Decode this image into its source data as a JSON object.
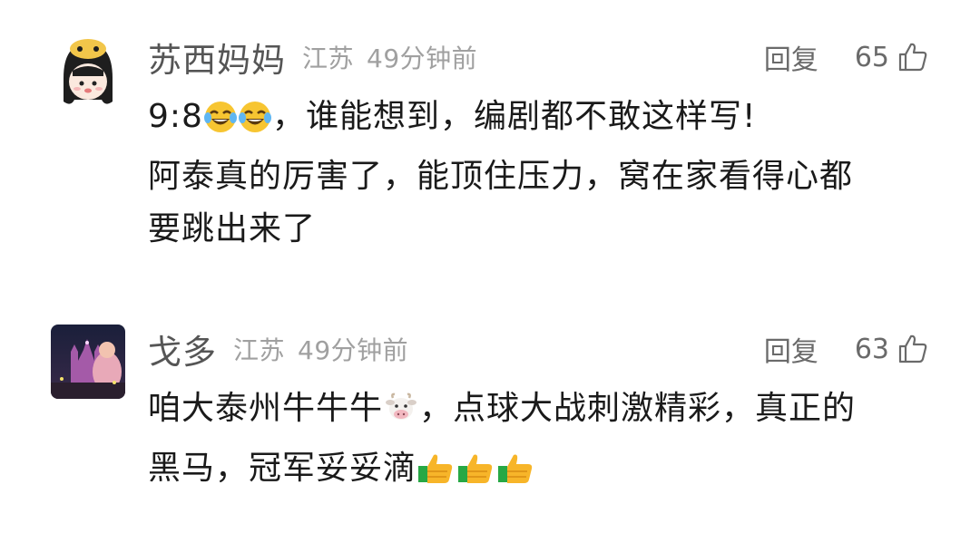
{
  "comments": [
    {
      "username": "苏西妈妈",
      "location": "江苏",
      "time": "49分钟前",
      "reply_label": "回复",
      "likes": "65",
      "avatar": "cartoon-girl-avatar",
      "lines": [
        [
          "9:8",
          "",
          "",
          "，谁能想到，编剧都不敢这样写!"
        ],
        [
          "阿泰真的厉害了，能顶住压力，窝在家看得心都"
        ],
        [
          "要跳出来了"
        ]
      ],
      "emojis": [
        "laughing-tears-emoji",
        "laughing-tears-emoji"
      ]
    },
    {
      "username": "戈多",
      "location": "江苏",
      "time": "49分钟前",
      "reply_label": "回复",
      "likes": "63",
      "avatar": "night-castle-photo-avatar",
      "line1_text": "咱大泰州牛牛牛",
      "line1_rest": "，点球大战刺激精彩，真正的",
      "line2_text": "黑马，冠军妥妥滴",
      "emojis": [
        "cow-emoji",
        "thumbs-up-emoji",
        "thumbs-up-emoji",
        "thumbs-up-emoji"
      ]
    }
  ],
  "colors": {
    "username": "#555555",
    "meta": "#a0a0a0",
    "text": "#1a1a1a"
  }
}
